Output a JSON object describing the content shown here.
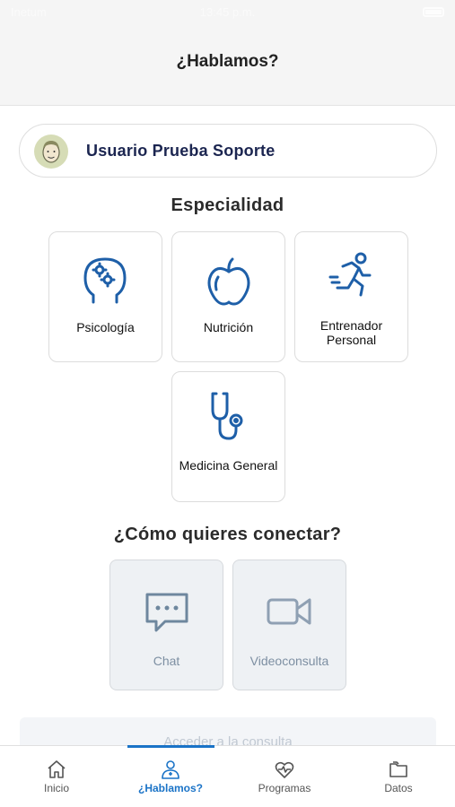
{
  "status_bar": {
    "carrier": "Inetum",
    "time": "13:45 p.m."
  },
  "header": {
    "title": "¿Hablamos?"
  },
  "user": {
    "name": "Usuario Prueba Soporte",
    "avatar_icon": "user-face-icon"
  },
  "specialties": {
    "title": "Especialidad",
    "items": [
      {
        "label": "Psicología",
        "icon": "brain-gears-icon"
      },
      {
        "label": "Nutrición",
        "icon": "apple-icon"
      },
      {
        "label": "Entrenador Personal",
        "icon": "runner-icon"
      },
      {
        "label": "Medicina General",
        "icon": "stethoscope-icon"
      }
    ]
  },
  "connection": {
    "title": "¿Cómo quieres conectar?",
    "options": [
      {
        "label": "Chat",
        "icon": "chat-bubble-icon"
      },
      {
        "label": "Videoconsulta",
        "icon": "video-camera-icon"
      }
    ]
  },
  "access_button": {
    "label": "Acceder a la consulta"
  },
  "tab_bar": {
    "active": "¿Hablamos?",
    "tabs": [
      {
        "label": "Inicio",
        "icon": "home-icon"
      },
      {
        "label": "¿Hablamos?",
        "icon": "doctor-icon"
      },
      {
        "label": "Programas",
        "icon": "heart-pulse-icon"
      },
      {
        "label": "Datos",
        "icon": "folder-icon"
      }
    ]
  },
  "colors": {
    "accent": "#1a73c7",
    "icon_blue": "#1e5fa8",
    "navy_text": "#1b2550",
    "muted": "#7d8fa2"
  }
}
